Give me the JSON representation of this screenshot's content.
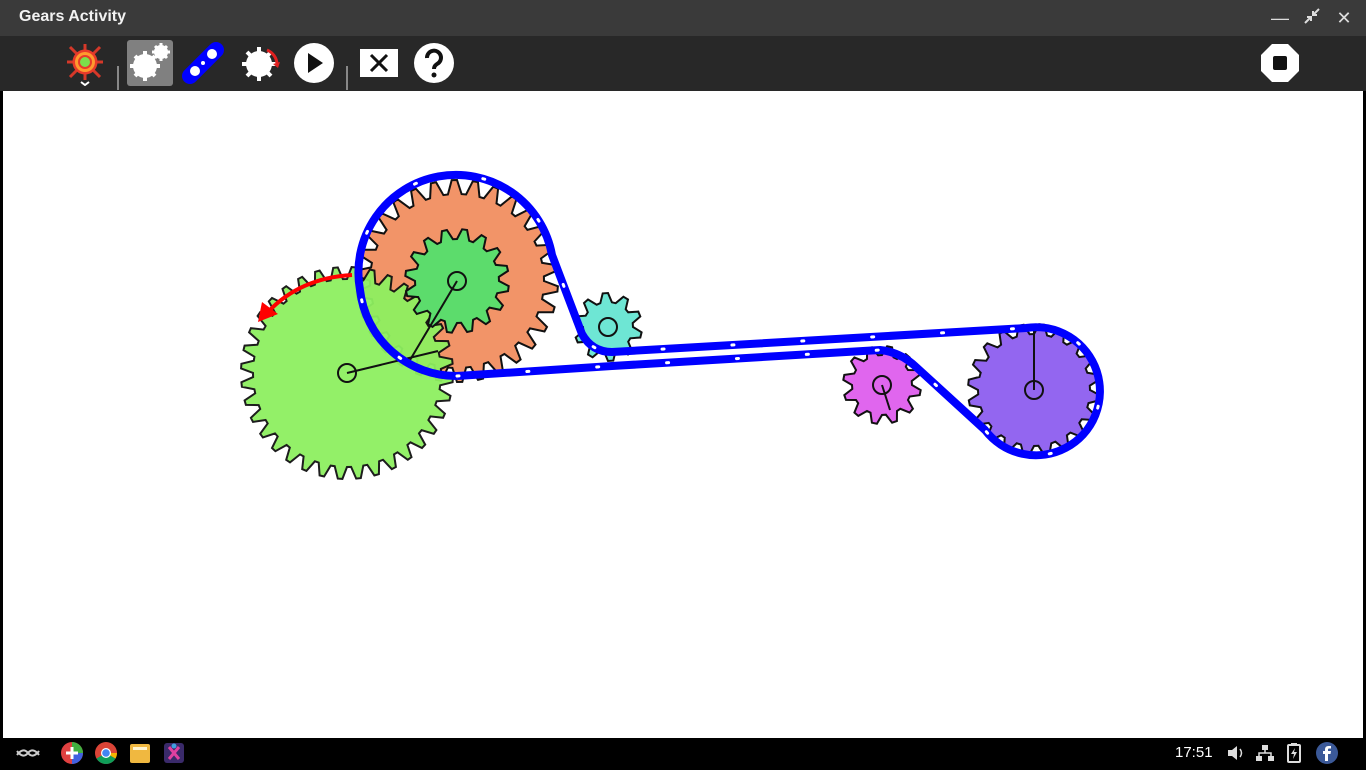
{
  "window": {
    "title": "Gears Activity"
  },
  "toolbar": {
    "tools": [
      {
        "name": "activity-gear-icon"
      },
      {
        "name": "gears-tool",
        "active": true
      },
      {
        "name": "chain-tool"
      },
      {
        "name": "motor-gear-tool"
      },
      {
        "name": "play-button"
      },
      {
        "name": "clear-button"
      },
      {
        "name": "help-button"
      },
      {
        "name": "stop-button"
      }
    ]
  },
  "canvas": {
    "gears": [
      {
        "color": "#8ef060",
        "teeth": 36
      },
      {
        "color": "#f29468",
        "teeth": 30
      },
      {
        "color": "#5cdc6c",
        "teeth": 16
      },
      {
        "color": "#6ee6d4",
        "teeth": 10
      },
      {
        "color": "#e066ee",
        "teeth": 12
      },
      {
        "color": "#9366f0",
        "teeth": 20
      }
    ],
    "chain_color": "#0000ff",
    "motor_arrow_color": "#ff0000"
  },
  "taskbar": {
    "clock": "17:51"
  }
}
